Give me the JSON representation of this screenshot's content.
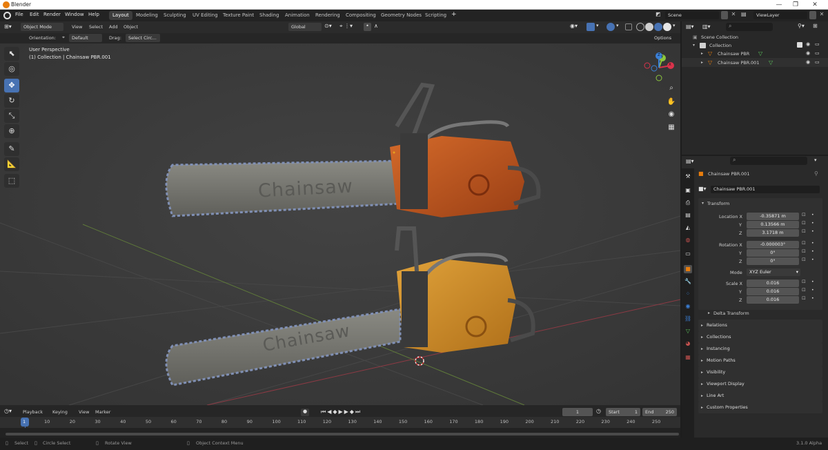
{
  "window": {
    "title": "Blender",
    "minimize": "—",
    "maximize": "❐",
    "close": "✕"
  },
  "menu": [
    "File",
    "Edit",
    "Render",
    "Window",
    "Help"
  ],
  "workspaces": [
    "Layout",
    "Modeling",
    "Sculpting",
    "UV Editing",
    "Texture Paint",
    "Shading",
    "Animation",
    "Rendering",
    "Compositing",
    "Geometry Nodes",
    "Scripting"
  ],
  "add_workspace": "+",
  "scene": {
    "name": "Scene",
    "view_layer": "ViewLayer"
  },
  "viewport_header": {
    "mode": "Object Mode",
    "menus": [
      "View",
      "Select",
      "Add",
      "Object"
    ],
    "transform": "Global",
    "orientation_label": "Orientation:",
    "orientation_value": "Default",
    "drag_label": "Drag:",
    "drag_value": "Select Circ...",
    "options": "Options"
  },
  "viewport": {
    "perspective": "User Perspective",
    "collection_info": "(1) Collection | Chainsaw PBR.001",
    "engraving": "Chainsaw",
    "gizmo_axes": [
      "X",
      "Y",
      "Z"
    ]
  },
  "outliner": {
    "items": [
      {
        "label": "Scene Collection"
      },
      {
        "label": "Collection"
      },
      {
        "label": "Chainsaw PBR"
      },
      {
        "label": "Chainsaw PBR.001"
      }
    ]
  },
  "properties": {
    "object_name": "Chainsaw PBR.001",
    "object_field": "Chainsaw PBR.001",
    "transform_title": "Transform",
    "location_label": "Location X",
    "location": [
      "-0.35871 m",
      "0.13566 m",
      "3.1718 m"
    ],
    "rotation_label": "Rotation X",
    "rotation": [
      "-0.000003°",
      "0°",
      "0°"
    ],
    "mode_label": "Mode",
    "mode": "XYZ Euler",
    "scale_label": "Scale X",
    "scale": [
      "0.016",
      "0.016",
      "0.016"
    ],
    "axis_y": "Y",
    "axis_z": "Z",
    "delta": "Delta Transform",
    "sections": [
      "Relations",
      "Collections",
      "Instancing",
      "Motion Paths",
      "Visibility",
      "Viewport Display",
      "Line Art",
      "Custom Properties"
    ]
  },
  "timeline": {
    "menus": [
      "Playback",
      "Keying",
      "View",
      "Marker"
    ],
    "current_frame": "1",
    "start_label": "Start",
    "start": "1",
    "end_label": "End",
    "end": "250",
    "ticks": [
      "1",
      "10",
      "20",
      "30",
      "40",
      "50",
      "60",
      "70",
      "80",
      "90",
      "100",
      "110",
      "120",
      "130",
      "140",
      "150",
      "160",
      "170",
      "180",
      "190",
      "200",
      "210",
      "220",
      "230",
      "240",
      "250"
    ]
  },
  "status": {
    "items": [
      "Select",
      "Circle Select",
      "Rotate View",
      "Object Context Menu"
    ],
    "version": "3.1.0 Alpha"
  },
  "colors": {
    "accent": "#4772b3",
    "orange": "#e87d0d",
    "x_axis": "#d9334b",
    "y_axis": "#8cc63f",
    "z_axis": "#3b80d8"
  }
}
